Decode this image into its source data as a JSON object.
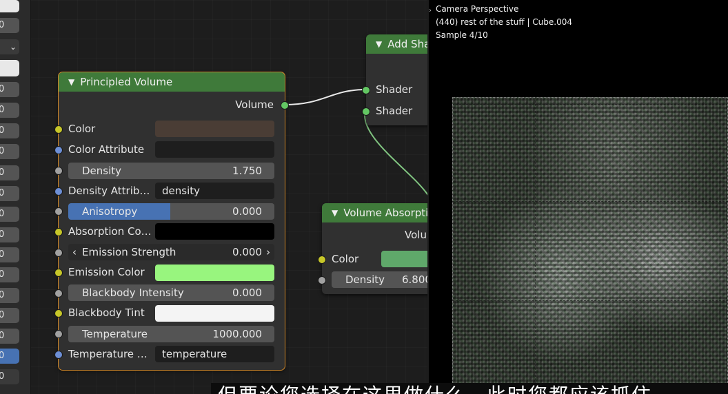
{
  "left_strip": {
    "fields": [
      "0",
      "",
      "",
      "0",
      "0",
      "0",
      "0",
      "0",
      "0",
      "0",
      "0",
      "0",
      "0",
      "0",
      "0",
      "0",
      "0",
      "0"
    ]
  },
  "principled_volume": {
    "title": "Principled Volume",
    "output": "Volume",
    "rows": {
      "color": "Color",
      "color_attribute": "Color Attribute",
      "density_label": "Density",
      "density_value": "1.750",
      "density_attribute": "Density Attrib…",
      "density_attribute_value": "density",
      "anisotropy_label": "Anisotropy",
      "anisotropy_value": "0.000",
      "absorption_color": "Absorption Co…",
      "emission_strength_label": "Emission Strength",
      "emission_strength_value": "0.000",
      "emission_color": "Emission Color",
      "blackbody_intensity_label": "Blackbody Intensity",
      "blackbody_intensity_value": "0.000",
      "blackbody_tint": "Blackbody Tint",
      "temperature_label": "Temperature",
      "temperature_value": "1000.000",
      "temperature_attribute": "Temperature …",
      "temperature_attribute_value": "temperature"
    },
    "colors": {
      "color_swatch": "#4a3d35",
      "color_attribute_swatch": "#1e1e1e",
      "absorption_swatch": "#000000",
      "emission_swatch": "#98f57e",
      "blackbody_tint_swatch": "#f4f4f4"
    }
  },
  "add_shader": {
    "title": "Add Sha",
    "inputs": [
      "Shader",
      "Shader"
    ]
  },
  "volume_absorption": {
    "title": "Volume Absorptio",
    "output": "Volu",
    "color_label": "Color",
    "color_swatch": "#5fa86a",
    "density_label": "Density",
    "density_value": "6.800"
  },
  "viewport": {
    "line1": "Camera Perspective",
    "line2": "(440) rest of the stuff | Cube.004",
    "line3": "Sample 4/10"
  },
  "subtitle": "但要论您选择在这里做什么，此时您都应该抓住"
}
